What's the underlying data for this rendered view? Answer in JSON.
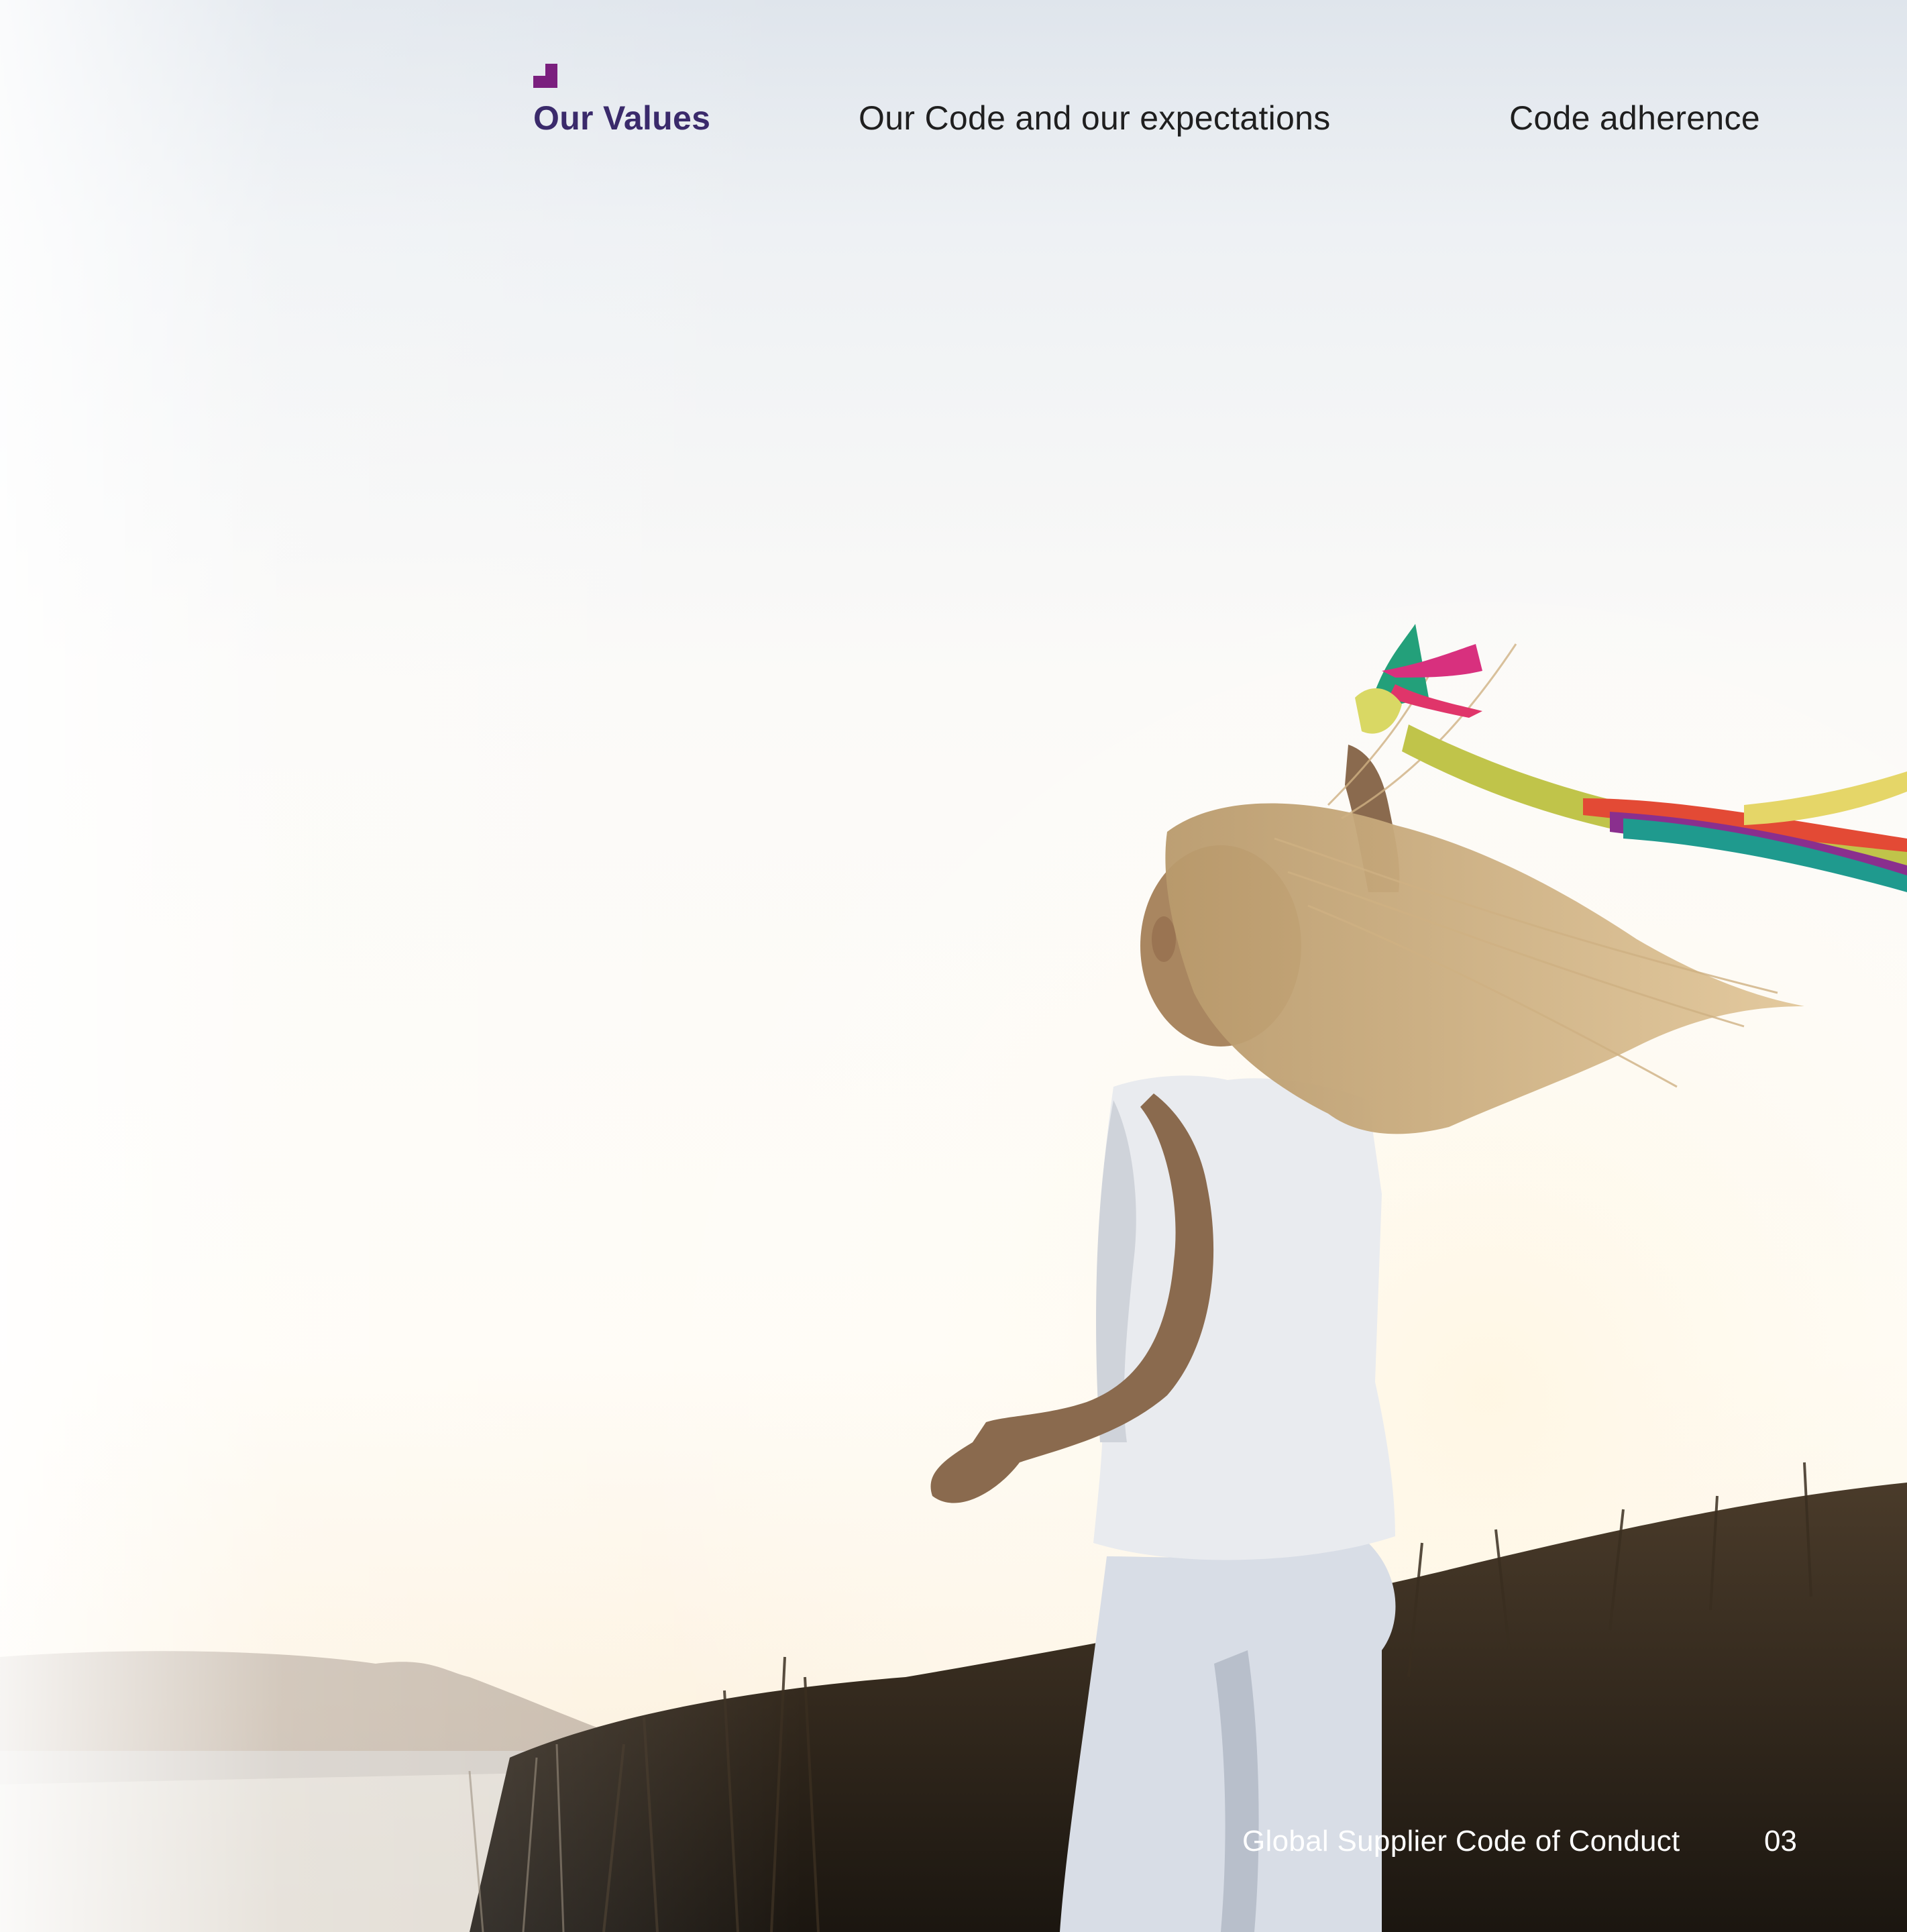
{
  "nav": {
    "items": [
      {
        "label": "Our Values",
        "active": true
      },
      {
        "label": "Our Code and our expectations",
        "active": false
      },
      {
        "label": "Code adherence",
        "active": false
      }
    ],
    "accent_color": "#7a1f7e",
    "active_color": "#3a2a6b"
  },
  "hero_image": {
    "icon": "girl-running-with-ribbons-photo"
  },
  "footer": {
    "document_title": "Global Supplier Code of Conduct",
    "page_number": "03"
  }
}
